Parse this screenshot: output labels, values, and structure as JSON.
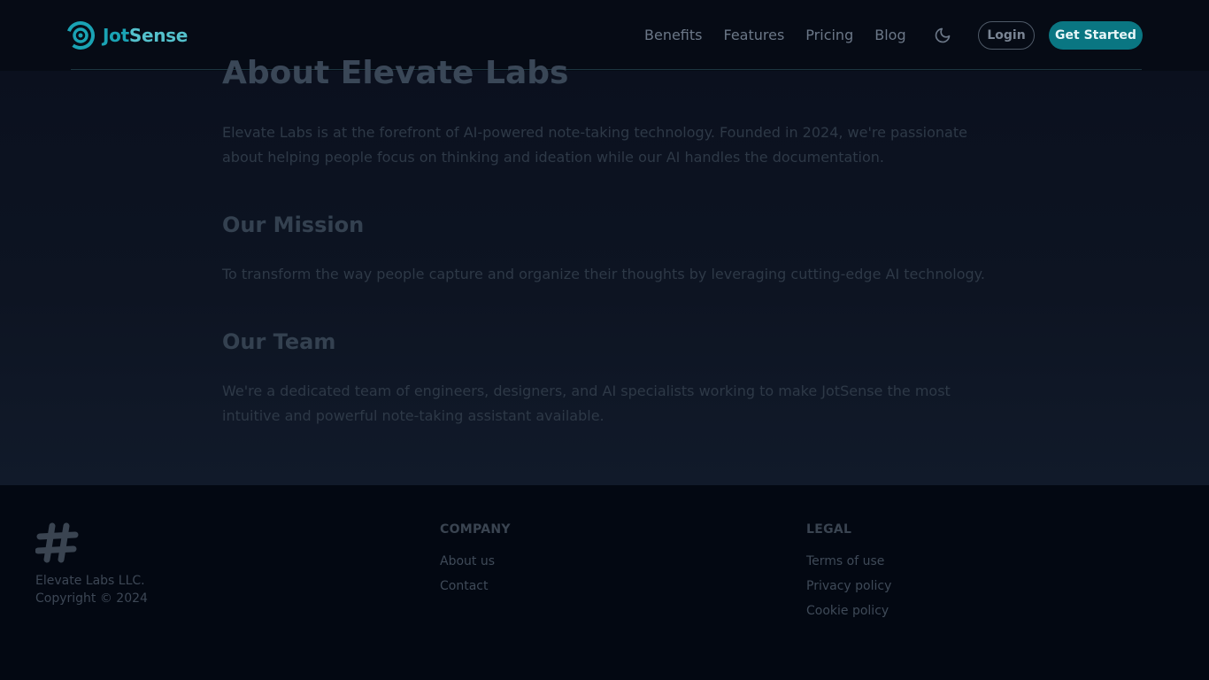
{
  "header": {
    "brand": {
      "name_part1": "Jot",
      "name_part2": "Sense"
    },
    "nav": [
      {
        "label": "Benefits"
      },
      {
        "label": "Features"
      },
      {
        "label": "Pricing"
      },
      {
        "label": "Blog"
      }
    ],
    "theme_toggle_icon": "moon-icon",
    "login_label": "Login",
    "cta_label": "Get Started"
  },
  "main": {
    "title": "About Elevate Labs",
    "intro": "Elevate Labs is at the forefront of AI-powered note-taking technology. Founded in 2024, we're passionate about helping people focus on thinking and ideation while our AI handles the documentation.",
    "mission_heading": "Our Mission",
    "mission_text": "To transform the way people capture and organize their thoughts by leveraging cutting-edge AI technology.",
    "team_heading": "Our Team",
    "team_text": "We're a dedicated team of engineers, designers, and AI specialists working to make JotSense the most intuitive and powerful note-taking assistant available."
  },
  "footer": {
    "logo_icon": "hash-icon",
    "company_name": "Elevate Labs LLC.",
    "copyright": "Copyright © 2024",
    "columns": [
      {
        "heading": "COMPANY",
        "links": [
          "About us",
          "Contact"
        ]
      },
      {
        "heading": "LEGAL",
        "links": [
          "Terms of use",
          "Privacy policy",
          "Cookie policy"
        ]
      }
    ]
  },
  "colors": {
    "accent": "#0a7682",
    "brand_teal": "#1aa3b4",
    "background": "#0a0f1d",
    "footer_background": "#030812"
  }
}
